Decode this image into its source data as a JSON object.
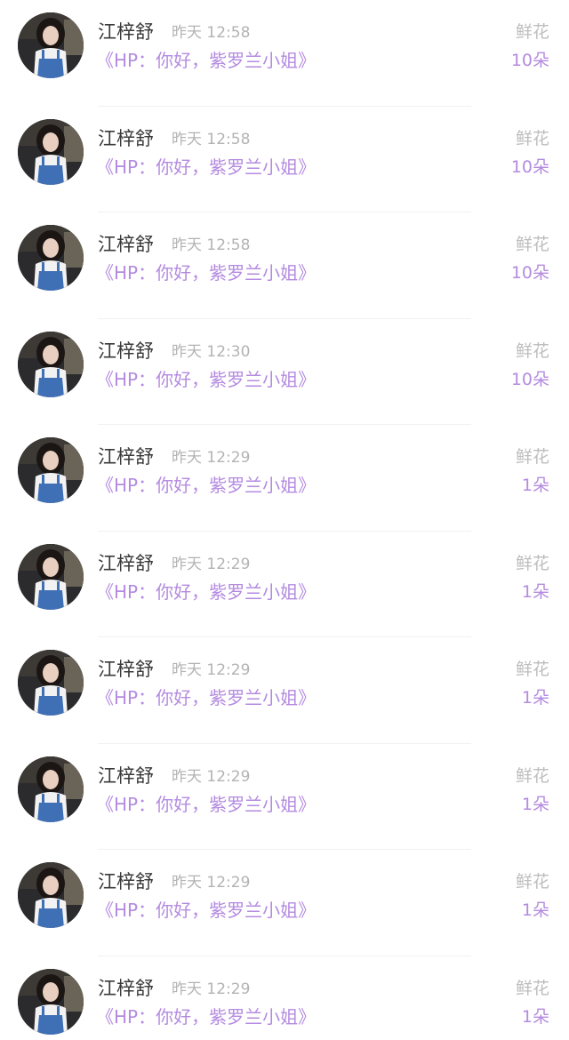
{
  "colors": {
    "accent_purple": "#b48be0",
    "name_text": "#3a3a3a",
    "meta_text": "#b3b3b3",
    "divider": "#f1f1f1"
  },
  "records": [
    {
      "name": "江梓舒",
      "time": "昨天 12:58",
      "title": "《HP：你好，紫罗兰小姐》",
      "gift": "鲜花",
      "count": "10朵",
      "avatar_icon": "user-avatar-photo"
    },
    {
      "name": "江梓舒",
      "time": "昨天 12:58",
      "title": "《HP：你好，紫罗兰小姐》",
      "gift": "鲜花",
      "count": "10朵",
      "avatar_icon": "user-avatar-photo"
    },
    {
      "name": "江梓舒",
      "time": "昨天 12:58",
      "title": "《HP：你好，紫罗兰小姐》",
      "gift": "鲜花",
      "count": "10朵",
      "avatar_icon": "user-avatar-photo"
    },
    {
      "name": "江梓舒",
      "time": "昨天 12:30",
      "title": "《HP：你好，紫罗兰小姐》",
      "gift": "鲜花",
      "count": "10朵",
      "avatar_icon": "user-avatar-photo"
    },
    {
      "name": "江梓舒",
      "time": "昨天 12:29",
      "title": "《HP：你好，紫罗兰小姐》",
      "gift": "鲜花",
      "count": "1朵",
      "avatar_icon": "user-avatar-photo"
    },
    {
      "name": "江梓舒",
      "time": "昨天 12:29",
      "title": "《HP：你好，紫罗兰小姐》",
      "gift": "鲜花",
      "count": "1朵",
      "avatar_icon": "user-avatar-photo"
    },
    {
      "name": "江梓舒",
      "time": "昨天 12:29",
      "title": "《HP：你好，紫罗兰小姐》",
      "gift": "鲜花",
      "count": "1朵",
      "avatar_icon": "user-avatar-photo"
    },
    {
      "name": "江梓舒",
      "time": "昨天 12:29",
      "title": "《HP：你好，紫罗兰小姐》",
      "gift": "鲜花",
      "count": "1朵",
      "avatar_icon": "user-avatar-photo"
    },
    {
      "name": "江梓舒",
      "time": "昨天 12:29",
      "title": "《HP：你好，紫罗兰小姐》",
      "gift": "鲜花",
      "count": "1朵",
      "avatar_icon": "user-avatar-photo"
    },
    {
      "name": "江梓舒",
      "time": "昨天 12:29",
      "title": "《HP：你好，紫罗兰小姐》",
      "gift": "鲜花",
      "count": "1朵",
      "avatar_icon": "user-avatar-photo"
    }
  ]
}
